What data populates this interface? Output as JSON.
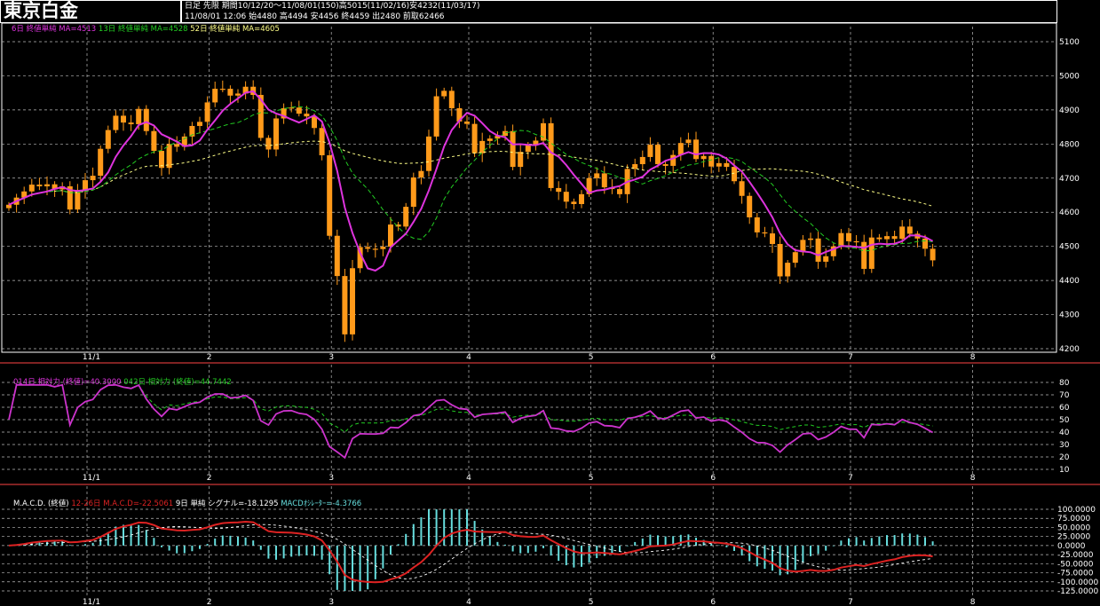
{
  "header": {
    "title": "東京白金",
    "line1": "日足  先限   期間10/12/20～11/08/01(150)高5015(11/02/16)安4232(11/03/17)",
    "line2": "11/08/01  12:06  始4480  高4494  安4456  終4459  出2480  前取62466"
  },
  "colors": {
    "candle": "#ff9a1a",
    "ma_short": "#dd33dd",
    "ma_mid": "#22cc22",
    "ma_long": "#ffff88",
    "rsi14": "#cc33cc",
    "rsi42": "#22cc22",
    "macd": "#dd2222",
    "signal": "#ffffff",
    "hist": "#66dddd",
    "grid": "#bbbbbb",
    "frame": "#ff4444"
  },
  "legends": {
    "main": [
      {
        "text": "6日 終値単純 MA=4513",
        "color": "#dd33dd"
      },
      {
        "text": "13日 終値単純 MA=4528",
        "color": "#22cc22"
      },
      {
        "text": "52日 終値単純 MA=4605",
        "color": "#ffff88"
      }
    ],
    "rsi": [
      {
        "text": "014日 相対力 (終値)=40.3000",
        "color": "#dd33dd"
      },
      {
        "text": "042日 相対力 (終値)=44.7442",
        "color": "#22cc22"
      }
    ],
    "macd": [
      {
        "text": "M.A.C.D. (終値)",
        "color": "#ffffff"
      },
      {
        "text": "12-26日 M.A.C.D=-22.5061",
        "color": "#dd2222"
      },
      {
        "text": "9日 単純 シグナル=-18.1295",
        "color": "#ffffff"
      },
      {
        "text": "MACDｵｼﾚｰﾀｰ=-4.3766",
        "color": "#66dddd"
      }
    ]
  },
  "chart_data": [
    {
      "type": "candlestick",
      "ylim": [
        4200,
        5150
      ],
      "yticks": [
        4200,
        4300,
        4400,
        4500,
        4600,
        4700,
        4800,
        4900,
        5000,
        5100
      ],
      "xtick_labels": [
        "11/1",
        "2",
        "3",
        "4",
        "5",
        "6",
        "7",
        "8"
      ],
      "xtick_index": [
        5,
        21,
        37,
        55,
        71,
        87,
        105,
        121
      ],
      "close": [
        4622,
        4643,
        4661,
        4681,
        4676,
        4682,
        4667,
        4676,
        4608,
        4665,
        4694,
        4707,
        4786,
        4841,
        4883,
        4863,
        4858,
        4903,
        4838,
        4780,
        4730,
        4800,
        4792,
        4822,
        4853,
        4865,
        4922,
        4962,
        4962,
        4942,
        4948,
        4968,
        4944,
        4818,
        4784,
        4875,
        4905,
        4907,
        4889,
        4881,
        4847,
        4767,
        4531,
        4413,
        4242,
        4436,
        4498,
        4493,
        4492,
        4499,
        4564,
        4558,
        4616,
        4702,
        4721,
        4822,
        4940,
        4956,
        4905,
        4866,
        4859,
        4773,
        4809,
        4816,
        4824,
        4838,
        4733,
        4777,
        4798,
        4810,
        4861,
        4671,
        4660,
        4631,
        4624,
        4653,
        4700,
        4714,
        4673,
        4668,
        4653,
        4727,
        4741,
        4762,
        4798,
        4741,
        4736,
        4768,
        4803,
        4813,
        4756,
        4765,
        4734,
        4744,
        4733,
        4691,
        4648,
        4585,
        4541,
        4538,
        4507,
        4412,
        4452,
        4483,
        4519,
        4523,
        4455,
        4471,
        4500,
        4539,
        4515,
        4513,
        4434,
        4526,
        4521,
        4530,
        4522,
        4558,
        4537,
        4523,
        4493,
        4459
      ],
      "moving_averages": [
        {
          "period": 6,
          "last": 4513
        },
        {
          "period": 13,
          "last": 4528
        },
        {
          "period": 52,
          "last": 4605
        }
      ]
    },
    {
      "type": "line",
      "name": "RSI",
      "ylim": [
        10,
        80
      ],
      "yticks": [
        10,
        20,
        30,
        40,
        50,
        60,
        70,
        80
      ],
      "series": [
        {
          "period": 14,
          "last": 40.3
        },
        {
          "period": 42,
          "last": 44.7442
        }
      ]
    },
    {
      "type": "line",
      "name": "MACD",
      "ylim": [
        -125,
        100
      ],
      "yticks": [
        "100.0000",
        "75.0000",
        "50.0000",
        "25.0000",
        "0.0000",
        "-25.0000",
        "-50.0000",
        "-75.0000",
        "-100.0000",
        "-125.0000"
      ],
      "ytick_values": [
        100,
        75,
        50,
        25,
        0,
        -25,
        -50,
        -75,
        -100,
        -125
      ],
      "series": [
        {
          "macd_last": -22.5061,
          "signal_last": -18.1295,
          "osc_last": -4.3766
        }
      ]
    }
  ]
}
